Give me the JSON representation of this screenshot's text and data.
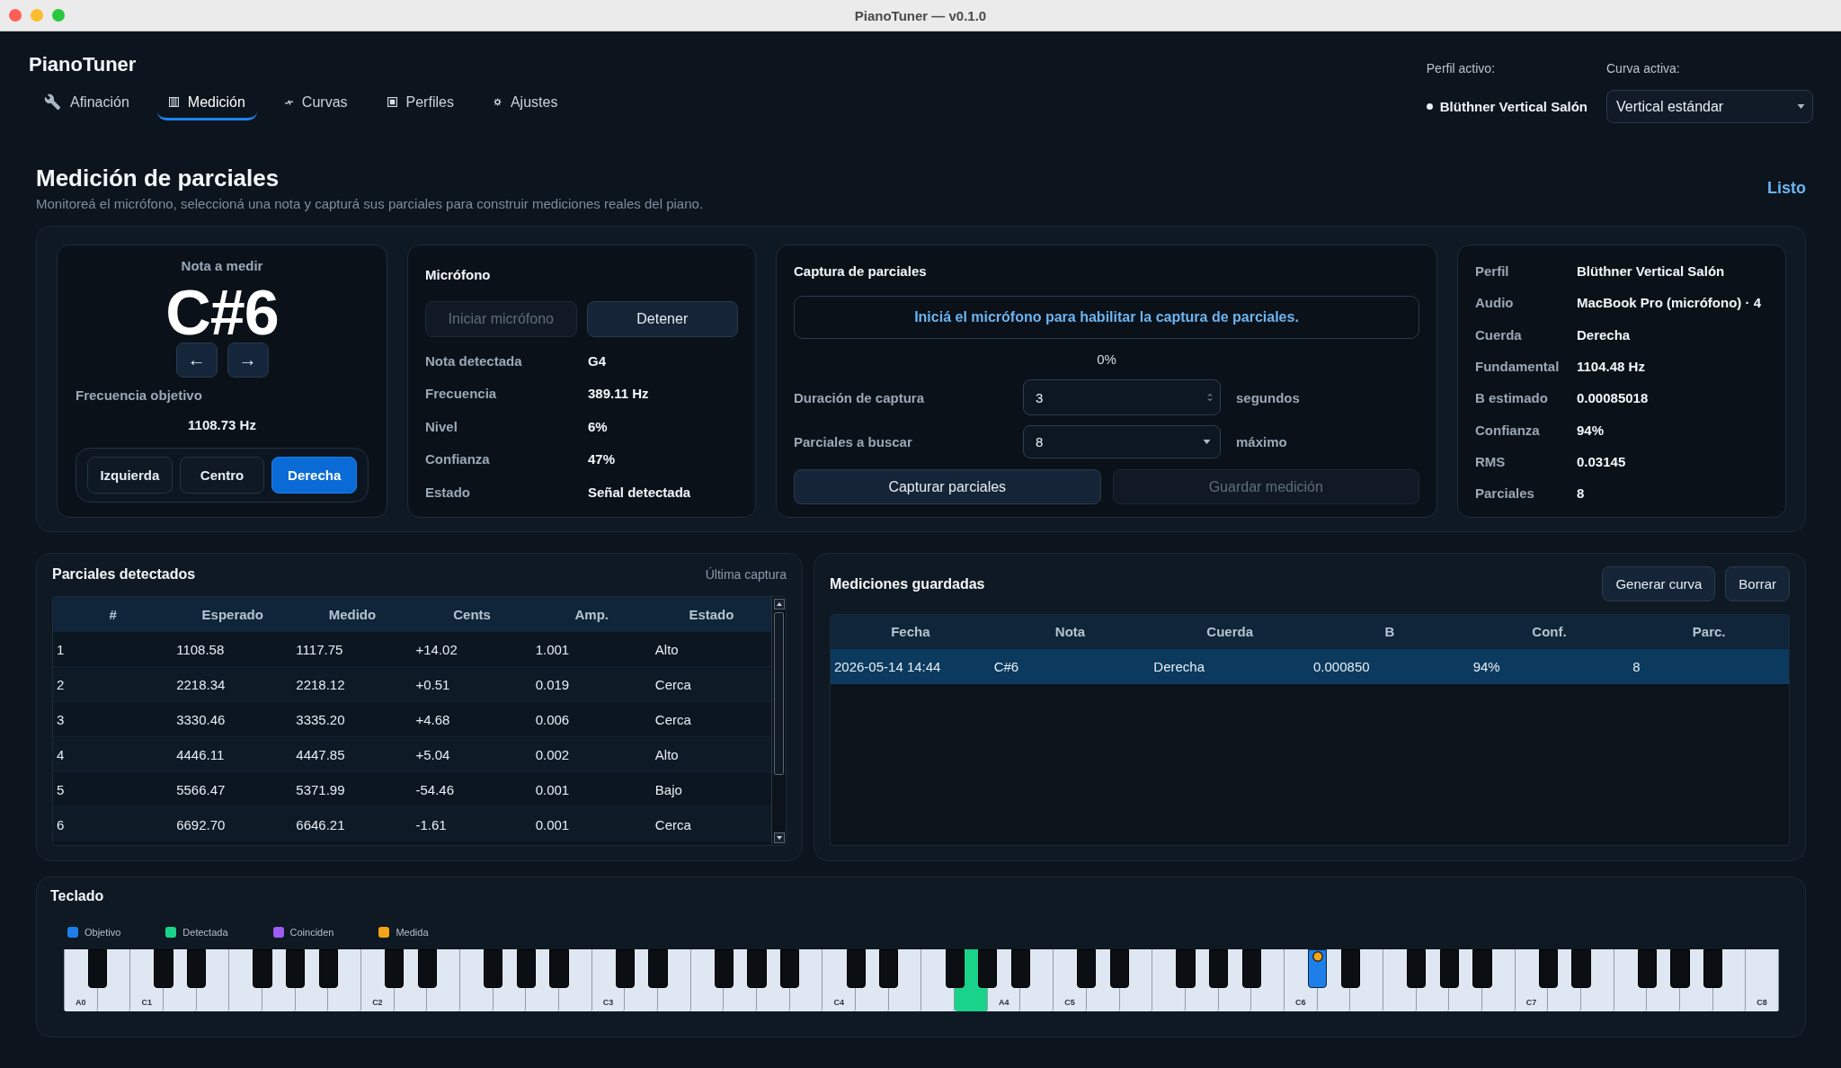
{
  "window": {
    "title": "PianoTuner — v0.1.0"
  },
  "app": {
    "name": "PianoTuner"
  },
  "tabs": [
    {
      "label": "Afinación",
      "selected": false
    },
    {
      "label": "Medición",
      "selected": true
    },
    {
      "label": "Curvas",
      "selected": false
    },
    {
      "label": "Perfiles",
      "selected": false
    },
    {
      "label": "Ajustes",
      "selected": false
    }
  ],
  "profile": {
    "label": "Perfil activo:",
    "value": "Blüthner Vertical Salón"
  },
  "curve": {
    "label": "Curva activa:",
    "value": "Vertical estándar"
  },
  "page": {
    "title": "Medición de parciales",
    "subtitle": "Monitoreá el micrófono, seleccioná una nota y capturá sus parciales para construir mediciones reales del piano.",
    "status": "Listo"
  },
  "note_card": {
    "title": "Nota a medir",
    "note": "C#6",
    "prev": "←",
    "next": "→",
    "frequency_label": "Frecuencia objetivo",
    "frequency": "1108.73 Hz",
    "strings": [
      {
        "label": "Izquierda",
        "selected": false
      },
      {
        "label": "Centro",
        "selected": false
      },
      {
        "label": "Derecha",
        "selected": true
      }
    ]
  },
  "microphone": {
    "title": "Micrófono",
    "buttons": [
      {
        "label": "Iniciar micrófono",
        "disabled": true
      },
      {
        "label": "Detener",
        "disabled": false
      }
    ],
    "rows": [
      {
        "label": "Nota detectada",
        "value": "G4"
      },
      {
        "label": "Frecuencia",
        "value": "389.11 Hz"
      },
      {
        "label": "Nivel",
        "value": "6%"
      },
      {
        "label": "Confianza",
        "value": "47%"
      },
      {
        "label": "Estado",
        "value": "Señal detectada"
      }
    ]
  },
  "capture": {
    "title": "Captura de parciales",
    "notice": "Iniciá el micrófono para habilitar la captura de parciales.",
    "progress": "0%",
    "fields": [
      {
        "kind": "number",
        "label": "Duración de captura",
        "value": "3",
        "unit": "segundos"
      },
      {
        "kind": "select",
        "label": "Parciales a buscar",
        "value": "8",
        "unit": "máximo"
      }
    ],
    "buttons": [
      {
        "label": "Capturar parciales",
        "disabled": false
      },
      {
        "label": "Guardar medición",
        "disabled": true
      }
    ]
  },
  "summary": {
    "rows": [
      {
        "label": "Perfil",
        "value": "Blüthner Vertical Salón"
      },
      {
        "label": "Audio",
        "value": "MacBook Pro (micrófono) · 4"
      },
      {
        "label": "Cuerda",
        "value": "Derecha"
      },
      {
        "label": "Fundamental",
        "value": "1104.48 Hz"
      },
      {
        "label": "B estimado",
        "value": "0.00085018"
      },
      {
        "label": "Confianza",
        "value": "94%"
      },
      {
        "label": "RMS",
        "value": "0.03145"
      },
      {
        "label": "Parciales",
        "value": "8"
      }
    ]
  },
  "partials": {
    "title": "Parciales detectados",
    "note": "Última captura",
    "columns": [
      "#",
      "Esperado",
      "Medido",
      "Cents",
      "Amp.",
      "Estado"
    ],
    "rows": [
      [
        "1",
        "1108.58",
        "1117.75",
        "+14.02",
        "1.001",
        "Alto"
      ],
      [
        "2",
        "2218.34",
        "2218.12",
        "+0.51",
        "0.019",
        "Cerca"
      ],
      [
        "3",
        "3330.46",
        "3335.20",
        "+4.68",
        "0.006",
        "Cerca"
      ],
      [
        "4",
        "4446.11",
        "4447.85",
        "+5.04",
        "0.002",
        "Alto"
      ],
      [
        "5",
        "5566.47",
        "5371.99",
        "-54.46",
        "0.001",
        "Bajo"
      ],
      [
        "6",
        "6692.70",
        "6646.21",
        "-1.61",
        "0.001",
        "Cerca"
      ]
    ]
  },
  "measurements": {
    "title": "Mediciones guardadas",
    "buttons": [
      "Generar curva",
      "Borrar"
    ],
    "columns": [
      "Fecha",
      "Nota",
      "Cuerda",
      "B",
      "Conf.",
      "Parc."
    ],
    "rows": [
      {
        "cells": [
          "2026-05-14 14:44",
          "C#6",
          "Derecha",
          "0.000850",
          "94%",
          "8"
        ],
        "selected": true
      }
    ]
  },
  "keyboard": {
    "title": "Teclado",
    "legend": [
      {
        "kind": "target",
        "label": "Objetivo",
        "color": "#1f7fe8"
      },
      {
        "kind": "detected",
        "label": "Detectada",
        "color": "#19d38a"
      },
      {
        "kind": "match",
        "label": "Coinciden",
        "color": "#9d5cf2"
      },
      {
        "kind": "measured",
        "label": "Medida",
        "color": "#f2a516"
      }
    ],
    "keys": [
      {
        "kind": "white",
        "label": "A0",
        "target": false,
        "detected": false,
        "measured": false
      },
      {
        "kind": "black",
        "target": false,
        "detected": false,
        "measured": false
      },
      {
        "kind": "white",
        "target": false,
        "detected": false,
        "measured": false
      },
      {
        "kind": "white",
        "label": "C1",
        "target": false,
        "detected": false,
        "measured": false
      },
      {
        "kind": "black",
        "target": false,
        "detected": false,
        "measured": false
      },
      {
        "kind": "white",
        "target": false,
        "detected": false,
        "measured": false
      },
      {
        "kind": "black",
        "target": false,
        "detected": false,
        "measured": false
      },
      {
        "kind": "white",
        "target": false,
        "detected": false,
        "measured": false
      },
      {
        "kind": "white",
        "target": false,
        "detected": false,
        "measured": false
      },
      {
        "kind": "black",
        "target": false,
        "detected": false,
        "measured": false
      },
      {
        "kind": "white",
        "target": false,
        "detected": false,
        "measured": false
      },
      {
        "kind": "black",
        "target": false,
        "detected": false,
        "measured": false
      },
      {
        "kind": "white",
        "target": false,
        "detected": false,
        "measured": false
      },
      {
        "kind": "black",
        "target": false,
        "detected": false,
        "measured": false
      },
      {
        "kind": "white",
        "target": false,
        "detected": false,
        "measured": false
      },
      {
        "kind": "white",
        "label": "C2",
        "target": false,
        "detected": false,
        "measured": false
      },
      {
        "kind": "black",
        "target": false,
        "detected": false,
        "measured": false
      },
      {
        "kind": "white",
        "target": false,
        "detected": false,
        "measured": false
      },
      {
        "kind": "black",
        "target": false,
        "detected": false,
        "measured": false
      },
      {
        "kind": "white",
        "target": false,
        "detected": false,
        "measured": false
      },
      {
        "kind": "white",
        "target": false,
        "detected": false,
        "measured": false
      },
      {
        "kind": "black",
        "target": false,
        "detected": false,
        "measured": false
      },
      {
        "kind": "white",
        "target": false,
        "detected": false,
        "measured": false
      },
      {
        "kind": "black",
        "target": false,
        "detected": false,
        "measured": false
      },
      {
        "kind": "white",
        "target": false,
        "detected": false,
        "measured": false
      },
      {
        "kind": "black",
        "target": false,
        "detected": false,
        "measured": false
      },
      {
        "kind": "white",
        "target": false,
        "detected": false,
        "measured": false
      },
      {
        "kind": "white",
        "label": "C3",
        "target": false,
        "detected": false,
        "measured": false
      },
      {
        "kind": "black",
        "target": false,
        "detected": false,
        "measured": false
      },
      {
        "kind": "white",
        "target": false,
        "detected": false,
        "measured": false
      },
      {
        "kind": "black",
        "target": false,
        "detected": false,
        "measured": false
      },
      {
        "kind": "white",
        "target": false,
        "detected": false,
        "measured": false
      },
      {
        "kind": "white",
        "target": false,
        "detected": false,
        "measured": false
      },
      {
        "kind": "black",
        "target": false,
        "detected": false,
        "measured": false
      },
      {
        "kind": "white",
        "target": false,
        "detected": false,
        "measured": false
      },
      {
        "kind": "black",
        "target": false,
        "detected": false,
        "measured": false
      },
      {
        "kind": "white",
        "target": false,
        "detected": false,
        "measured": false
      },
      {
        "kind": "black",
        "target": false,
        "detected": false,
        "measured": false
      },
      {
        "kind": "white",
        "target": false,
        "detected": false,
        "measured": false
      },
      {
        "kind": "white",
        "label": "C4",
        "target": false,
        "detected": false,
        "measured": false
      },
      {
        "kind": "black",
        "target": false,
        "detected": false,
        "measured": false
      },
      {
        "kind": "white",
        "target": false,
        "detected": false,
        "measured": false
      },
      {
        "kind": "black",
        "target": false,
        "detected": false,
        "measured": false
      },
      {
        "kind": "white",
        "target": false,
        "detected": false,
        "measured": false
      },
      {
        "kind": "white",
        "target": false,
        "detected": false,
        "measured": false
      },
      {
        "kind": "black",
        "target": false,
        "detected": false,
        "measured": false
      },
      {
        "kind": "white",
        "target": false,
        "detected": true,
        "measured": false
      },
      {
        "kind": "black",
        "target": false,
        "detected": false,
        "measured": false
      },
      {
        "kind": "white",
        "label": "A4",
        "target": false,
        "detected": false,
        "measured": false
      },
      {
        "kind": "black",
        "target": false,
        "detected": false,
        "measured": false
      },
      {
        "kind": "white",
        "target": false,
        "detected": false,
        "measured": false
      },
      {
        "kind": "white",
        "label": "C5",
        "target": false,
        "detected": false,
        "measured": false
      },
      {
        "kind": "black",
        "target": false,
        "detected": false,
        "measured": false
      },
      {
        "kind": "white",
        "target": false,
        "detected": false,
        "measured": false
      },
      {
        "kind": "black",
        "target": false,
        "detected": false,
        "measured": false
      },
      {
        "kind": "white",
        "target": false,
        "detected": false,
        "measured": false
      },
      {
        "kind": "white",
        "target": false,
        "detected": false,
        "measured": false
      },
      {
        "kind": "black",
        "target": false,
        "detected": false,
        "measured": false
      },
      {
        "kind": "white",
        "target": false,
        "detected": false,
        "measured": false
      },
      {
        "kind": "black",
        "target": false,
        "detected": false,
        "measured": false
      },
      {
        "kind": "white",
        "target": false,
        "detected": false,
        "measured": false
      },
      {
        "kind": "black",
        "target": false,
        "detected": false,
        "measured": false
      },
      {
        "kind": "white",
        "target": false,
        "detected": false,
        "measured": false
      },
      {
        "kind": "white",
        "label": "C6",
        "target": false,
        "detected": false,
        "measured": false
      },
      {
        "kind": "black",
        "target": true,
        "detected": false,
        "measured": true
      },
      {
        "kind": "white",
        "target": false,
        "detected": false,
        "measured": false
      },
      {
        "kind": "black",
        "target": false,
        "detected": false,
        "measured": false
      },
      {
        "kind": "white",
        "target": false,
        "detected": false,
        "measured": false
      },
      {
        "kind": "white",
        "target": false,
        "detected": false,
        "measured": false
      },
      {
        "kind": "black",
        "target": false,
        "detected": false,
        "measured": false
      },
      {
        "kind": "white",
        "target": false,
        "detected": false,
        "measured": false
      },
      {
        "kind": "black",
        "target": false,
        "detected": false,
        "measured": false
      },
      {
        "kind": "white",
        "target": false,
        "detected": false,
        "measured": false
      },
      {
        "kind": "black",
        "target": false,
        "detected": false,
        "measured": false
      },
      {
        "kind": "white",
        "target": false,
        "detected": false,
        "measured": false
      },
      {
        "kind": "white",
        "label": "C7",
        "target": false,
        "detected": false,
        "measured": false
      },
      {
        "kind": "black",
        "target": false,
        "detected": false,
        "measured": false
      },
      {
        "kind": "white",
        "target": false,
        "detected": false,
        "measured": false
      },
      {
        "kind": "black",
        "target": false,
        "detected": false,
        "measured": false
      },
      {
        "kind": "white",
        "target": false,
        "detected": false,
        "measured": false
      },
      {
        "kind": "white",
        "target": false,
        "detected": false,
        "measured": false
      },
      {
        "kind": "black",
        "target": false,
        "detected": false,
        "measured": false
      },
      {
        "kind": "white",
        "target": false,
        "detected": false,
        "measured": false
      },
      {
        "kind": "black",
        "target": false,
        "detected": false,
        "measured": false
      },
      {
        "kind": "white",
        "target": false,
        "detected": false,
        "measured": false
      },
      {
        "kind": "black",
        "target": false,
        "detected": false,
        "measured": false
      },
      {
        "kind": "white",
        "target": false,
        "detected": false,
        "measured": false
      },
      {
        "kind": "white",
        "label": "C8",
        "target": false,
        "detected": false,
        "measured": false
      }
    ]
  }
}
